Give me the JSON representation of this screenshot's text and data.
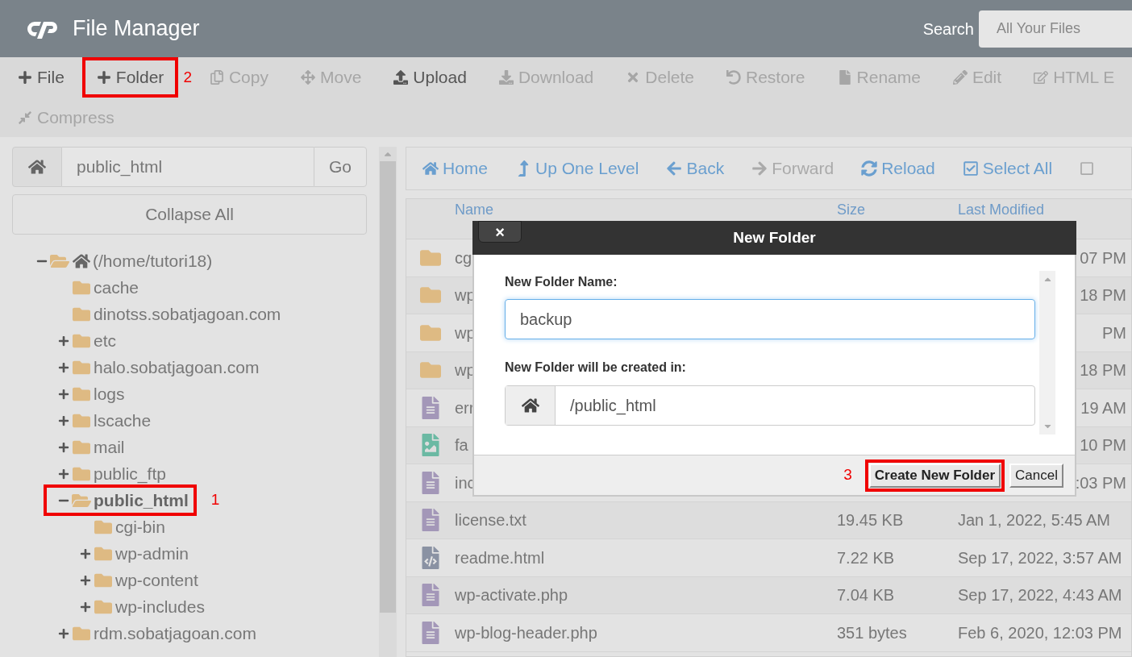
{
  "header": {
    "title": "File Manager",
    "search_label": "Search",
    "search_placeholder": "All Your Files"
  },
  "toolbar": {
    "rows": [
      {
        "items": [
          {
            "label": "File",
            "kind": "plus",
            "disabled": false,
            "highlighted": false
          },
          {
            "label": "Folder",
            "kind": "plus",
            "disabled": false,
            "highlighted": true,
            "step": "2"
          },
          {
            "label": "Copy",
            "kind": "copy",
            "disabled": true,
            "highlighted": false
          },
          {
            "label": "Move",
            "kind": "move",
            "disabled": true,
            "highlighted": false
          },
          {
            "label": "Upload",
            "kind": "upload",
            "disabled": false,
            "highlighted": false
          },
          {
            "label": "Download",
            "kind": "download",
            "disabled": true,
            "highlighted": false
          },
          {
            "label": "Delete",
            "kind": "delete",
            "disabled": true,
            "highlighted": false
          },
          {
            "label": "Restore",
            "kind": "restore",
            "disabled": true,
            "highlighted": false
          },
          {
            "label": "Rename",
            "kind": "file",
            "disabled": true,
            "highlighted": false
          },
          {
            "label": "Edit",
            "kind": "pencil",
            "disabled": true,
            "highlighted": false
          },
          {
            "label": "HTML E",
            "kind": "edit",
            "disabled": true,
            "highlighted": false
          }
        ]
      },
      {
        "items": [
          {
            "label": "Compress",
            "kind": "compress",
            "disabled": true,
            "highlighted": false
          }
        ]
      }
    ]
  },
  "path_bar": {
    "value": "public_html",
    "go": "Go"
  },
  "collapse_all": "Collapse All",
  "tree": [
    {
      "label": "(/home/tutori18)",
      "kind": "home",
      "expanded": true,
      "selected": false,
      "highlighted": false,
      "children": [
        {
          "label": "cache",
          "kind": "leaf",
          "selected": false,
          "highlighted": false
        },
        {
          "label": "dinotss.sobatjagoan.com",
          "kind": "leaf",
          "selected": false,
          "highlighted": false
        },
        {
          "label": "etc",
          "kind": "branch",
          "expanded": false,
          "selected": false,
          "highlighted": false
        },
        {
          "label": "halo.sobatjagoan.com",
          "kind": "branch",
          "expanded": false,
          "selected": false,
          "highlighted": false
        },
        {
          "label": "logs",
          "kind": "branch",
          "expanded": false,
          "selected": false,
          "highlighted": false
        },
        {
          "label": "lscache",
          "kind": "branch",
          "expanded": false,
          "selected": false,
          "highlighted": false
        },
        {
          "label": "mail",
          "kind": "branch",
          "expanded": false,
          "selected": false,
          "highlighted": false
        },
        {
          "label": "public_ftp",
          "kind": "branch",
          "expanded": false,
          "selected": false,
          "highlighted": false
        },
        {
          "label": "public_html",
          "kind": "branch",
          "expanded": true,
          "selected": true,
          "highlighted": true,
          "step": "1",
          "children": [
            {
              "label": "cgi-bin",
              "kind": "leaf",
              "selected": false,
              "highlighted": false
            },
            {
              "label": "wp-admin",
              "kind": "branch",
              "expanded": false,
              "selected": false,
              "highlighted": false
            },
            {
              "label": "wp-content",
              "kind": "branch",
              "expanded": false,
              "selected": false,
              "highlighted": false
            },
            {
              "label": "wp-includes",
              "kind": "branch",
              "expanded": false,
              "selected": false,
              "highlighted": false
            }
          ]
        },
        {
          "label": "rdm.sobatjagoan.com",
          "kind": "branch",
          "expanded": false,
          "selected": false,
          "highlighted": false
        }
      ]
    }
  ],
  "nav": [
    {
      "label": "Home",
      "kind": "home",
      "disabled": false
    },
    {
      "label": "Up One Level",
      "kind": "up",
      "disabled": false
    },
    {
      "label": "Back",
      "kind": "back",
      "disabled": false
    },
    {
      "label": "Forward",
      "kind": "forward",
      "disabled": true
    },
    {
      "label": "Reload",
      "kind": "reload",
      "disabled": false
    },
    {
      "label": "Select All",
      "kind": "checkall",
      "disabled": false
    }
  ],
  "table": {
    "columns": [
      "Name",
      "Size",
      "Last Modified"
    ],
    "rows": [
      {
        "kind": "folder",
        "name": "cg",
        "modified": "07 PM"
      },
      {
        "kind": "folder",
        "name": "wp",
        "modified": "18 PM"
      },
      {
        "kind": "folder",
        "name": "wp",
        "modified": "PM"
      },
      {
        "kind": "folder",
        "name": "wp",
        "modified": "18 PM"
      },
      {
        "kind": "doc",
        "name": "err",
        "modified": "19 AM"
      },
      {
        "kind": "image",
        "name": "fa",
        "modified": "10 PM"
      },
      {
        "kind": "doc",
        "name": "inc",
        "modified": ":03 PM"
      },
      {
        "kind": "doc",
        "name": "license.txt",
        "size": "19.45 KB",
        "modified": "Jan 1, 2022, 5:45 AM"
      },
      {
        "kind": "code",
        "name": "readme.html",
        "size": "7.22 KB",
        "modified": "Sep 17, 2022, 3:57 AM"
      },
      {
        "kind": "doc",
        "name": "wp-activate.php",
        "size": "7.04 KB",
        "modified": "Sep 17, 2022, 4:43 AM"
      },
      {
        "kind": "doc",
        "name": "wp-blog-header.php",
        "size": "351 bytes",
        "modified": "Feb 6, 2020, 12:03 PM"
      }
    ]
  },
  "dialog": {
    "title": "New Folder",
    "close": "×",
    "name_label": "New Folder Name:",
    "name_value": "backup",
    "location_label": "New Folder will be created in:",
    "location_value": "/public_html",
    "buttons": [
      {
        "label": "Create New Folder",
        "highlighted": true,
        "step": "3"
      },
      {
        "label": "Cancel",
        "highlighted": false
      }
    ]
  }
}
